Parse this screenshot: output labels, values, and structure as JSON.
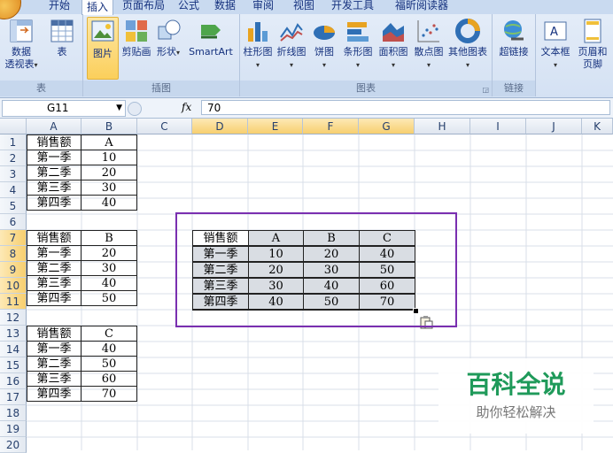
{
  "tabs": [
    "开始",
    "插入",
    "页面布局",
    "公式",
    "数据",
    "审阅",
    "视图",
    "开发工具",
    "福昕阅读器"
  ],
  "active_tab": "插入",
  "ribbon": {
    "groups": [
      {
        "label": "表",
        "buttons": [
          "数据\n透视表",
          "表"
        ]
      },
      {
        "label": "插图",
        "buttons": [
          "图片",
          "剪贴画",
          "形状",
          "SmartArt"
        ]
      },
      {
        "label": "图表",
        "buttons": [
          "柱形图",
          "折线图",
          "饼图",
          "条形图",
          "面积图",
          "散点图",
          "其他图表"
        ]
      },
      {
        "label": "链接",
        "buttons": [
          "超链接"
        ]
      },
      {
        "label": "",
        "buttons": [
          "文本框",
          "页眉和\n页脚"
        ]
      }
    ]
  },
  "formula_bar": {
    "name_box": "G11",
    "fx": "fx",
    "value": "70"
  },
  "columns": [
    "A",
    "B",
    "C",
    "D",
    "E",
    "F",
    "G",
    "H",
    "I",
    "J",
    "K"
  ],
  "rows": [
    "1",
    "2",
    "3",
    "4",
    "5",
    "6",
    "7",
    "8",
    "9",
    "10",
    "11",
    "12",
    "13",
    "14",
    "15",
    "16",
    "17",
    "18",
    "19",
    "20"
  ],
  "cells": {
    "table1": [
      [
        "销售额",
        "A"
      ],
      [
        "第一季",
        "10"
      ],
      [
        "第二季",
        "20"
      ],
      [
        "第三季",
        "30"
      ],
      [
        "第四季",
        "40"
      ]
    ],
    "table2": [
      [
        "销售额",
        "B"
      ],
      [
        "第一季",
        "20"
      ],
      [
        "第二季",
        "30"
      ],
      [
        "第三季",
        "40"
      ],
      [
        "第四季",
        "50"
      ]
    ],
    "table3": [
      [
        "销售额",
        "C"
      ],
      [
        "第一季",
        "40"
      ],
      [
        "第二季",
        "50"
      ],
      [
        "第三季",
        "60"
      ],
      [
        "第四季",
        "70"
      ]
    ],
    "merged": [
      [
        "销售额",
        "A",
        "B",
        "C"
      ],
      [
        "第一季",
        "10",
        "20",
        "40"
      ],
      [
        "第二季",
        "20",
        "30",
        "50"
      ],
      [
        "第三季",
        "30",
        "40",
        "60"
      ],
      [
        "第四季",
        "40",
        "50",
        "70"
      ]
    ]
  },
  "annotation_color": "#7a2fb0",
  "watermark": {
    "title": "百科全说",
    "subtitle": "助你轻松解决"
  }
}
